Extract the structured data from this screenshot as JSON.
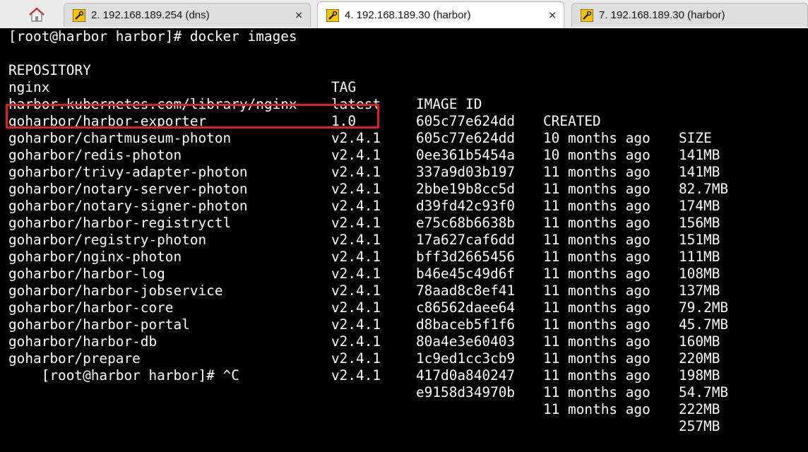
{
  "tabs": [
    {
      "label": "2. 192.168.189.254 (dns)",
      "active": false
    },
    {
      "label": "4. 192.168.189.30 (harbor)",
      "active": true
    },
    {
      "label": "7. 192.168.189.30 (harbor)",
      "active": false
    }
  ],
  "terminal": {
    "command_line": "[root@harbor harbor]# docker images",
    "headers": {
      "repository": "REPOSITORY",
      "tag": "TAG",
      "image_id": "IMAGE ID",
      "created": "CREATED",
      "size": "SIZE"
    },
    "rows": [
      {
        "repository": "nginx",
        "tag": "latest",
        "image_id": "605c77e624dd",
        "created": "10 months ago",
        "size": "141MB"
      },
      {
        "repository": "harbor.kubernetes.com/library/nginx",
        "tag": "1.0",
        "image_id": "605c77e624dd",
        "created": "10 months ago",
        "size": "141MB"
      },
      {
        "repository": "goharbor/harbor-exporter",
        "tag": "v2.4.1",
        "image_id": "0ee361b5454a",
        "created": "11 months ago",
        "size": "82.7MB"
      },
      {
        "repository": "goharbor/chartmuseum-photon",
        "tag": "v2.4.1",
        "image_id": "337a9d03b197",
        "created": "11 months ago",
        "size": "174MB"
      },
      {
        "repository": "goharbor/redis-photon",
        "tag": "v2.4.1",
        "image_id": "2bbe19b8cc5d",
        "created": "11 months ago",
        "size": "156MB"
      },
      {
        "repository": "goharbor/trivy-adapter-photon",
        "tag": "v2.4.1",
        "image_id": "d39fd42c93f0",
        "created": "11 months ago",
        "size": "151MB"
      },
      {
        "repository": "goharbor/notary-server-photon",
        "tag": "v2.4.1",
        "image_id": "e75c68b6638b",
        "created": "11 months ago",
        "size": "111MB"
      },
      {
        "repository": "goharbor/notary-signer-photon",
        "tag": "v2.4.1",
        "image_id": "17a627caf6dd",
        "created": "11 months ago",
        "size": "108MB"
      },
      {
        "repository": "goharbor/harbor-registryctl",
        "tag": "v2.4.1",
        "image_id": "bff3d2665456",
        "created": "11 months ago",
        "size": "137MB"
      },
      {
        "repository": "goharbor/registry-photon",
        "tag": "v2.4.1",
        "image_id": "b46e45c49d6f",
        "created": "11 months ago",
        "size": "79.2MB"
      },
      {
        "repository": "goharbor/nginx-photon",
        "tag": "v2.4.1",
        "image_id": "78aad8c8ef41",
        "created": "11 months ago",
        "size": "45.7MB"
      },
      {
        "repository": "goharbor/harbor-log",
        "tag": "v2.4.1",
        "image_id": "c86562daee64",
        "created": "11 months ago",
        "size": "160MB"
      },
      {
        "repository": "goharbor/harbor-jobservice",
        "tag": "v2.4.1",
        "image_id": "d8baceb5f1f6",
        "created": "11 months ago",
        "size": "220MB"
      },
      {
        "repository": "goharbor/harbor-core",
        "tag": "v2.4.1",
        "image_id": "80a4e3e60403",
        "created": "11 months ago",
        "size": "198MB"
      },
      {
        "repository": "goharbor/harbor-portal",
        "tag": "v2.4.1",
        "image_id": "1c9ed1cc3cb9",
        "created": "11 months ago",
        "size": "54.7MB"
      },
      {
        "repository": "goharbor/harbor-db",
        "tag": "v2.4.1",
        "image_id": "417d0a840247",
        "created": "11 months ago",
        "size": "222MB"
      },
      {
        "repository": "goharbor/prepare",
        "tag": "v2.4.1",
        "image_id": "e9158d34970b",
        "created": "11 months ago",
        "size": "257MB"
      }
    ],
    "prompt_line": "[root@harbor harbor]# ^C"
  },
  "colors": {
    "highlight": "#e02020",
    "terminal_bg": "#000000",
    "terminal_fg": "#ffffff"
  }
}
